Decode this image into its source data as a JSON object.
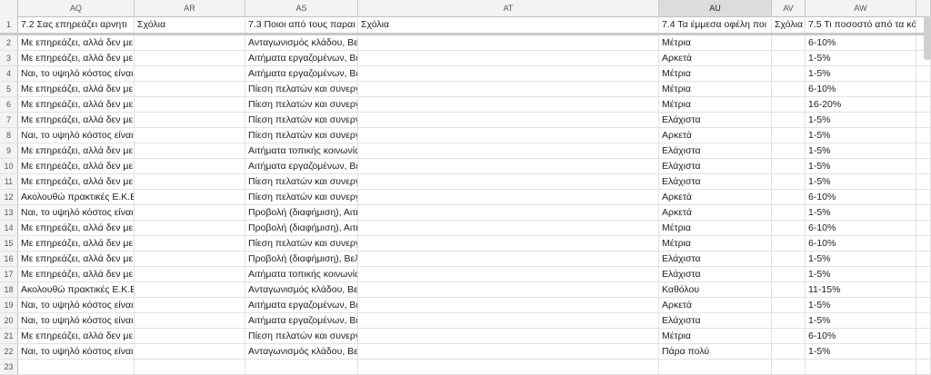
{
  "columns": [
    "AQ",
    "AR",
    "AS",
    "AT",
    "AU",
    "AV",
    "AW",
    ""
  ],
  "header_row": {
    "num": "1",
    "cells": [
      "7.2 Σας επηρεάζει αρνητι",
      "Σχόλια",
      "7.3 Ποιοι από τους παραι",
      "Σχόλια",
      "7.4 Τα έμμεσα οφέλη ποι",
      "Σχόλια",
      "7.5 Τι ποσοστό από τα κό",
      ""
    ]
  },
  "rows": [
    {
      "num": "2",
      "cells": [
        "Με επηρεάζει, αλλά δεν με αποτρέπει",
        "",
        "Ανταγωνισμός κλάδου, Βελτίωση σχέσεων με επιχειρησιακό περιβάλλον",
        "",
        "Μέτρια",
        "",
        "6-10%",
        ""
      ]
    },
    {
      "num": "3",
      "cells": [
        "Με επηρεάζει, αλλά δεν με αποτρέπει",
        "",
        "Αιτήματα εργαζομένων, Βελτίωση σχέσεων με επιχειρησιακό περιβάλλον",
        "",
        "Αρκετά",
        "",
        "1-5%",
        ""
      ]
    },
    {
      "num": "4",
      "cells": [
        "Ναι, το υψηλό κόστος είναι αποτρεπτικό",
        "",
        "Αιτήματα εργαζομένων, Βελτίωση σχέσεων με επιχειρησιακό περιβάλλον",
        "",
        "Μέτρια",
        "",
        "1-5%",
        ""
      ]
    },
    {
      "num": "5",
      "cells": [
        "Με επηρεάζει, αλλά δεν με αποτρέπει",
        "",
        "Πίεση πελατών και συνεργατών, Αιτήματα τοπικής κοινωνίας, Ανταγωνισμός κλάδου, Βελτίωση σχέσεων",
        "",
        "Μέτρια",
        "",
        "6-10%",
        ""
      ]
    },
    {
      "num": "6",
      "cells": [
        "Με επηρεάζει, αλλά δεν με αποτρέπει",
        "",
        "Πίεση πελατών και συνεργατών, Βελτίωση σχέσεων με επιχειρησιακό περιβάλλον",
        "",
        "Μέτρια",
        "",
        "16-20%",
        ""
      ]
    },
    {
      "num": "7",
      "cells": [
        "Με επηρεάζει, αλλά δεν με αποτρέπει",
        "",
        "Πίεση πελατών και συνεργατών, Βελτίωση σχέσεων με επιχειρησιακό περιβάλλον",
        "",
        "Ελάχιστα",
        "",
        "1-5%",
        ""
      ]
    },
    {
      "num": "8",
      "cells": [
        "Ναι, το υψηλό κόστος είναι αποτρεπτικό",
        "",
        "Πίεση πελατών και συνεργατών, Ανταγωνισμός κλάδου",
        "",
        "Αρκετά",
        "",
        "1-5%",
        ""
      ]
    },
    {
      "num": "9",
      "cells": [
        "Με επηρεάζει, αλλά δεν με αποτρέπει",
        "",
        "Αιτήματα τοπικής κοινωνίας, Αιτήματα εργαζομένων, Βελτίωση σχέσεων με επιχειρησιακό περιβάλλον",
        "",
        "Ελάχιστα",
        "",
        "1-5%",
        ""
      ]
    },
    {
      "num": "10",
      "cells": [
        "Με επηρεάζει, αλλά δεν με αποτρέπει",
        "",
        "Αιτήματα εργαζομένων, Βελτίωση σχέσεων με επιχειρησιακό περιβάλλον",
        "",
        "Ελάχιστα",
        "",
        "1-5%",
        ""
      ]
    },
    {
      "num": "11",
      "cells": [
        "Με επηρεάζει, αλλά δεν με αποτρέπει",
        "",
        "Πίεση πελατών και συνεργατών, Ανταγωνισμός κλάδου, Βελτίωση σχέσεων με επιχειρησιακό περιβάλλον",
        "",
        "Ελάχιστα",
        "",
        "1-5%",
        ""
      ]
    },
    {
      "num": "12",
      "cells": [
        "Ακολουθώ πρακτικές Ε.Κ.Ε. ανεξαρτήτως κόστους",
        "",
        "Πίεση πελατών και συνεργατών, Βελτίωση σχέσεων με επιχειρησιακό περιβάλλον",
        "",
        "Αρκετά",
        "",
        "6-10%",
        ""
      ]
    },
    {
      "num": "13",
      "cells": [
        "Ναι, το υψηλό κόστος είναι αποτρεπτικό",
        "",
        "Προβολή (διαφήμιση), Αιτήματα τοπικής κοινωνίας, Ανταγωνισμός κλάδου",
        "",
        "Αρκετά",
        "",
        "1-5%",
        ""
      ]
    },
    {
      "num": "14",
      "cells": [
        "Με επηρεάζει, αλλά δεν με αποτρέπει",
        "",
        "Προβολή (διαφήμιση), Αιτήματα τοπικής κοινωνίας, Αιτήματα εργαζομένων",
        "",
        "Μέτρια",
        "",
        "6-10%",
        ""
      ]
    },
    {
      "num": "15",
      "cells": [
        "Με επηρεάζει, αλλά δεν με αποτρέπει",
        "",
        "Πίεση πελατών και συνεργατών, Ανταγωνισμός κλάδου, Βελτίωση σχέσεων με επιχειρησιακό περιβάλλον",
        "",
        "Μέτρια",
        "",
        "6-10%",
        ""
      ]
    },
    {
      "num": "16",
      "cells": [
        "Με επηρεάζει, αλλά δεν με αποτρέπει",
        "",
        "Προβολή (διαφήμιση), Βελτίωση σχέσεων με επιχειρησιακό περιβάλλον",
        "",
        "Ελάχιστα",
        "",
        "1-5%",
        ""
      ]
    },
    {
      "num": "17",
      "cells": [
        "Με επηρεάζει, αλλά δεν με αποτρέπει",
        "",
        "Αιτήματα τοπικής κοινωνίας, Βελτίωση σχέσεων με επιχειρησιακό περιβάλλον",
        "",
        "Ελάχιστα",
        "",
        "1-5%",
        ""
      ]
    },
    {
      "num": "18",
      "cells": [
        "Ακολουθώ πρακτικές Ε.Κ.Ε. ανεξαρτήτως κόστους",
        "",
        "Ανταγωνισμός κλάδου, Βελτίωση σχέσεων με επιχειρησιακό περιβάλλον",
        "",
        "Καθόλου",
        "",
        "11-15%",
        ""
      ]
    },
    {
      "num": "19",
      "cells": [
        "Ναι, το υψηλό κόστος είναι αποτρεπτικό",
        "",
        "Αιτήματα εργαζομένων, Βελτίωση σχέσεων με επιχειρησιακό περιβάλλον",
        "",
        "Αρκετά",
        "",
        "1-5%",
        ""
      ]
    },
    {
      "num": "20",
      "cells": [
        "Ναι, το υψηλό κόστος είναι αποτρεπτικό",
        "",
        "Αιτήματα εργαζομένων, Βελτίωση σχέσεων με επιχειρησιακό περιβάλλον",
        "",
        "Ελάχιστα",
        "",
        "1-5%",
        ""
      ]
    },
    {
      "num": "21",
      "cells": [
        "Με επηρεάζει, αλλά δεν με αποτρέπει",
        "",
        "Πίεση πελατών και συνεργατών, Ανταγωνισμός κλάδου, Βελτίωση σχέσεων με επιχειρησιακό περιβάλλον",
        "",
        "Μέτρια",
        "",
        "6-10%",
        ""
      ]
    },
    {
      "num": "22",
      "cells": [
        "Ναι, το υψηλό κόστος είναι αποτρεπτικό",
        "",
        "Ανταγωνισμός κλάδου, Βελτίωση σχέσεων με επιχειρησιακό περιβάλλον",
        "",
        "Πάρα πολύ",
        "",
        "1-5%",
        ""
      ]
    },
    {
      "num": "23",
      "cells": [
        "",
        "",
        "",
        "",
        "",
        "",
        "",
        ""
      ]
    }
  ]
}
